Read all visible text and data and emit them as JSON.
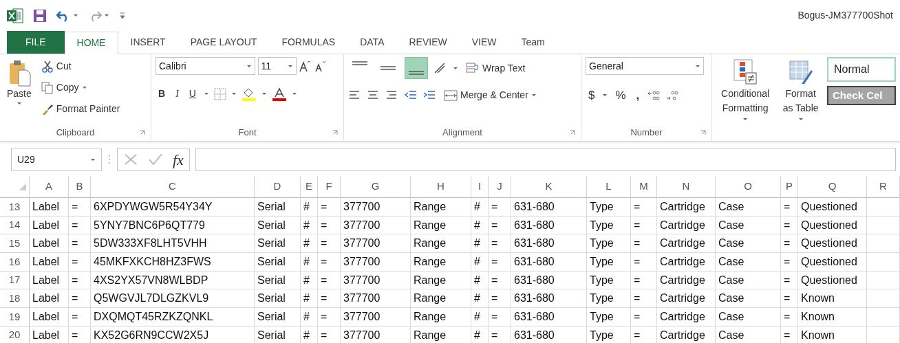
{
  "window": {
    "title": "Bogus-JM377700Shot"
  },
  "tabs": [
    {
      "label": "FILE",
      "kind": "file",
      "selected": false
    },
    {
      "label": "HOME",
      "kind": "tab",
      "selected": true
    },
    {
      "label": "INSERT",
      "kind": "tab",
      "selected": false
    },
    {
      "label": "PAGE LAYOUT",
      "kind": "tab",
      "selected": false
    },
    {
      "label": "FORMULAS",
      "kind": "tab",
      "selected": false
    },
    {
      "label": "DATA",
      "kind": "tab",
      "selected": false
    },
    {
      "label": "REVIEW",
      "kind": "tab",
      "selected": false
    },
    {
      "label": "VIEW",
      "kind": "tab",
      "selected": false
    },
    {
      "label": "Team",
      "kind": "tab",
      "selected": false
    }
  ],
  "ribbon": {
    "clipboard": {
      "label": "Clipboard",
      "paste": "Paste",
      "cut": "Cut",
      "copy": "Copy",
      "format_painter": "Format Painter"
    },
    "font": {
      "label": "Font",
      "font_name": "Calibri",
      "font_size": "11",
      "bold": "B",
      "italic": "I",
      "underline": "U"
    },
    "alignment": {
      "label": "Alignment",
      "vertical": [
        {
          "kind": "top",
          "selected": false
        },
        {
          "kind": "middle",
          "selected": false
        },
        {
          "kind": "bottom",
          "selected": true
        }
      ],
      "wrap_text": "Wrap Text",
      "merge_center": "Merge & Center"
    },
    "number": {
      "label": "Number",
      "format": "General",
      "currency": "$",
      "percent": "%",
      "comma": ","
    },
    "styles": {
      "conditional_formatting": "Conditional Formatting",
      "format_as_table": "Format as Table",
      "normal": "Normal",
      "check_cell": "Check Cel"
    }
  },
  "formula_bar": {
    "name_box": "U29",
    "function": "fx"
  },
  "sheet": {
    "columns": [
      "A",
      "B",
      "C",
      "D",
      "E",
      "F",
      "G",
      "H",
      "I",
      "J",
      "K",
      "L",
      "M",
      "N",
      "O",
      "P",
      "Q",
      "R"
    ],
    "rows": [
      {
        "number": "13",
        "cells": [
          "Label",
          "=",
          "6XPDYWGW5R54Y34Y",
          "Serial",
          "#",
          "=",
          "377700",
          "Range",
          "#",
          "=",
          "631-680",
          "Type",
          "=",
          "Cartridge",
          "Case",
          "=",
          "Questioned"
        ]
      },
      {
        "number": "14",
        "cells": [
          "Label",
          "=",
          "5YNY7BNC6P6QT779",
          "Serial",
          "#",
          "=",
          "377700",
          "Range",
          "#",
          "=",
          "631-680",
          "Type",
          "=",
          "Cartridge",
          "Case",
          "=",
          "Questioned"
        ]
      },
      {
        "number": "15",
        "cells": [
          "Label",
          "=",
          "5DW333XF8LHT5VHH",
          "Serial",
          "#",
          "=",
          "377700",
          "Range",
          "#",
          "=",
          "631-680",
          "Type",
          "=",
          "Cartridge",
          "Case",
          "=",
          "Questioned"
        ]
      },
      {
        "number": "16",
        "cells": [
          "Label",
          "=",
          "45MKFXKCH8HZ3FWS",
          "Serial",
          "#",
          "=",
          "377700",
          "Range",
          "#",
          "=",
          "631-680",
          "Type",
          "=",
          "Cartridge",
          "Case",
          "=",
          "Questioned"
        ]
      },
      {
        "number": "17",
        "cells": [
          "Label",
          "=",
          "4XS2YX57VN8WLBDP",
          "Serial",
          "#",
          "=",
          "377700",
          "Range",
          "#",
          "=",
          "631-680",
          "Type",
          "=",
          "Cartridge",
          "Case",
          "=",
          "Questioned"
        ]
      },
      {
        "number": "18",
        "cells": [
          "Label",
          "=",
          "Q5WGVJL7DLGZKVL9",
          "Serial",
          "#",
          "=",
          "377700",
          "Range",
          "#",
          "=",
          "631-680",
          "Type",
          "=",
          "Cartridge",
          "Case",
          "=",
          "Known"
        ]
      },
      {
        "number": "19",
        "cells": [
          "Label",
          "=",
          "DXQMQT45RZKZQNKL",
          "Serial",
          "#",
          "=",
          "377700",
          "Range",
          "#",
          "=",
          "631-680",
          "Type",
          "=",
          "Cartridge",
          "Case",
          "=",
          "Known"
        ]
      },
      {
        "number": "20",
        "cells": [
          "Label",
          "=",
          "KX52G6RN9CCW2X5J",
          "Serial",
          "#",
          "=",
          "377700",
          "Range",
          "#",
          "=",
          "631-680",
          "Type",
          "=",
          "Cartridge",
          "Case",
          "=",
          "Known"
        ]
      }
    ]
  }
}
